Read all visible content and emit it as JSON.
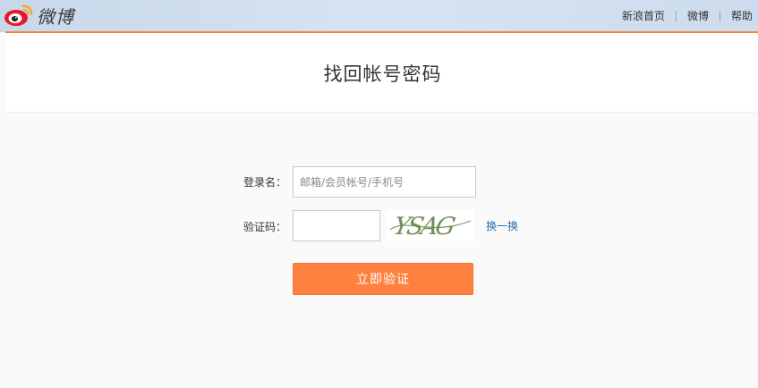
{
  "header": {
    "logo_text": "微博",
    "nav": [
      {
        "label": "新浪首页"
      },
      {
        "label": "微博"
      },
      {
        "label": "帮助"
      }
    ]
  },
  "page": {
    "title": "找回帐号密码"
  },
  "form": {
    "login_label": "登录名：",
    "login_placeholder": "邮箱/会员帐号/手机号",
    "login_value": "",
    "captcha_label": "验证码：",
    "captcha_value": "",
    "captcha_text": "YSAG",
    "refresh_label": "换一换",
    "submit_label": "立即验证"
  },
  "colors": {
    "accent": "#ff8140",
    "link": "#1f6fb2",
    "topbar": "#d6e3f2"
  }
}
